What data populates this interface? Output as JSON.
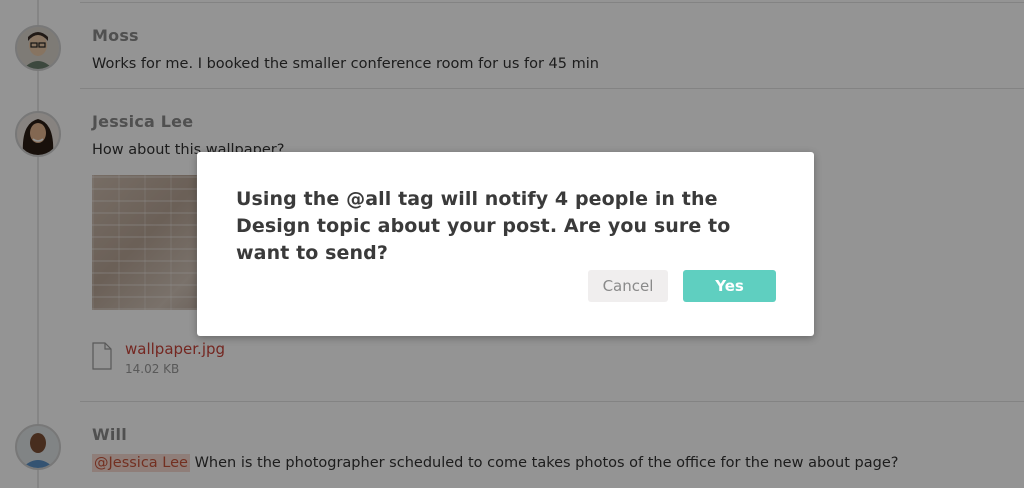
{
  "messages": [
    {
      "author": "Moss",
      "text": "Works for me. I booked the smaller conference room for us for 45 min"
    },
    {
      "author": "Jessica Lee",
      "text": "How about this wallpaper?",
      "attachment": {
        "file_name": "wallpaper.jpg",
        "file_size": "14.02 KB"
      }
    },
    {
      "author": "Will",
      "mention": "@Jessica Lee",
      "text": " When is the photographer scheduled to come takes photos of the office for the new about page?"
    }
  ],
  "dialog": {
    "message": "Using the @all tag will notify 4 people in the Design topic about your post. Are you sure to want to send?",
    "cancel_label": "Cancel",
    "confirm_label": "Yes"
  },
  "colors": {
    "accent": "#5fcfc0",
    "mention_text": "#c6533a",
    "file_link": "#c8443a"
  }
}
